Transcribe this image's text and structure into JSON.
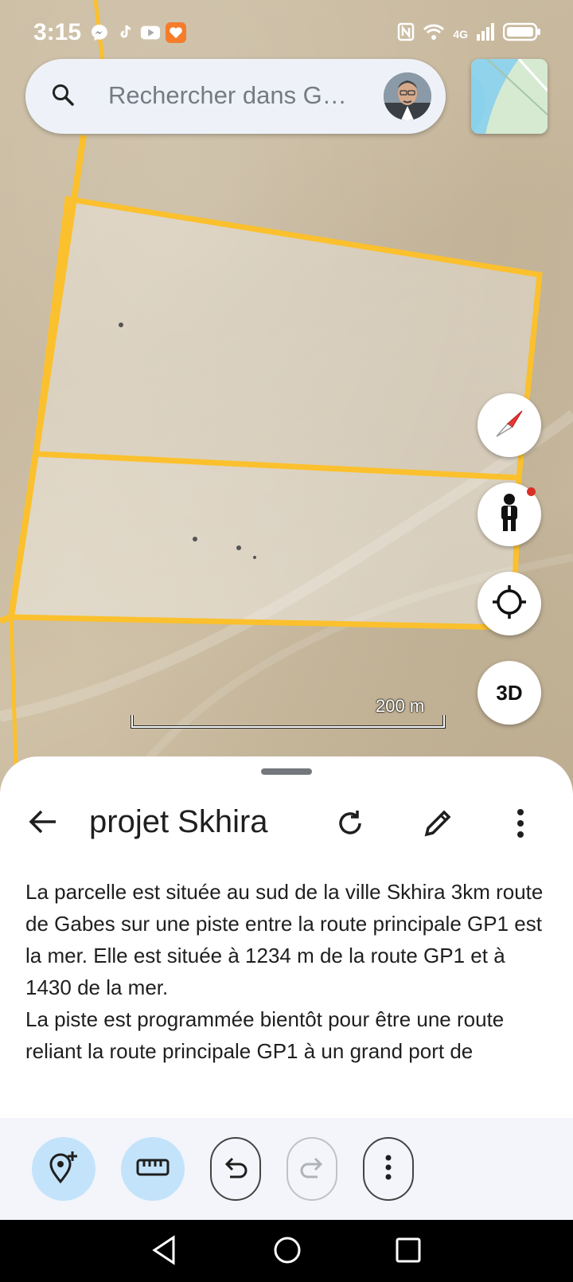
{
  "status_bar": {
    "time": "3:15",
    "network": "4G",
    "apps": [
      {
        "icon": "messenger-icon",
        "color": "#ffffff"
      },
      {
        "icon": "tiktok-icon",
        "color": "#ffffff"
      },
      {
        "icon": "youtube-icon",
        "color": "#ffffff"
      },
      {
        "icon": "heart-app-icon",
        "color": "#f57c2b"
      }
    ]
  },
  "search": {
    "placeholder": "Rechercher dans G…"
  },
  "map": {
    "scale_label": "200 m",
    "parcel_color": "#fbc02d",
    "controls": [
      "compass-icon",
      "pegman-icon",
      "my-location-icon",
      "3D"
    ]
  },
  "controls": {
    "three_d_label": "3D"
  },
  "sheet": {
    "title": "projet Skhira",
    "description": "La parcelle est située au sud de la ville Skhira 3km route de Gabes sur une piste entre la route principale GP1 est la mer. Elle est située à 1234 m de la route GP1 et à 1430 de la mer.\nLa piste est programmée bientôt pour être une route reliant la route principale GP1 à un grand port de marchandises et des unités industrielles qui seront réalisées bientôt."
  },
  "toolbar": {
    "buttons": [
      "add-placemark-icon",
      "measure-icon",
      "undo-icon",
      "redo-icon",
      "more-icon"
    ],
    "accent": "#c3e3fb"
  },
  "navbar": {
    "buttons": [
      "back-icon",
      "home-icon",
      "recents-icon"
    ]
  }
}
